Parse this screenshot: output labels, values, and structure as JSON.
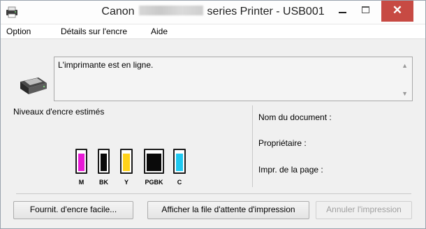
{
  "window": {
    "title_prefix": "Canon",
    "title_suffix": "series Printer - USB001",
    "close_glyph": "✕"
  },
  "menu": [
    "Option",
    "Détails sur l'encre",
    "Aide"
  ],
  "status": {
    "message": "L'imprimante est en ligne.",
    "scroll_up": "▲",
    "scroll_down": "▼"
  },
  "ink": {
    "title": "Niveaux d'encre estimés",
    "tanks": [
      {
        "label": "M",
        "color": "#e81ad6",
        "level": 0.9
      },
      {
        "label": "BK",
        "color": "#0a0a0a",
        "level": 0.9
      },
      {
        "label": "Y",
        "color": "#ffd21a",
        "level": 0.9
      },
      {
        "label": "PGBK",
        "color": "#0a0a0a",
        "level": 0.9
      },
      {
        "label": "C",
        "color": "#1ec8f0",
        "level": 0.9
      }
    ]
  },
  "info": {
    "document_name": "Nom du document :",
    "owner": "Propriétaire :",
    "page_printing": "Impr. de la page :"
  },
  "buttons": {
    "easy_ink": "Fournit. d'encre facile...",
    "show_queue": "Afficher la file d'attente d'impression",
    "cancel_print": "Annuler l'impression"
  }
}
